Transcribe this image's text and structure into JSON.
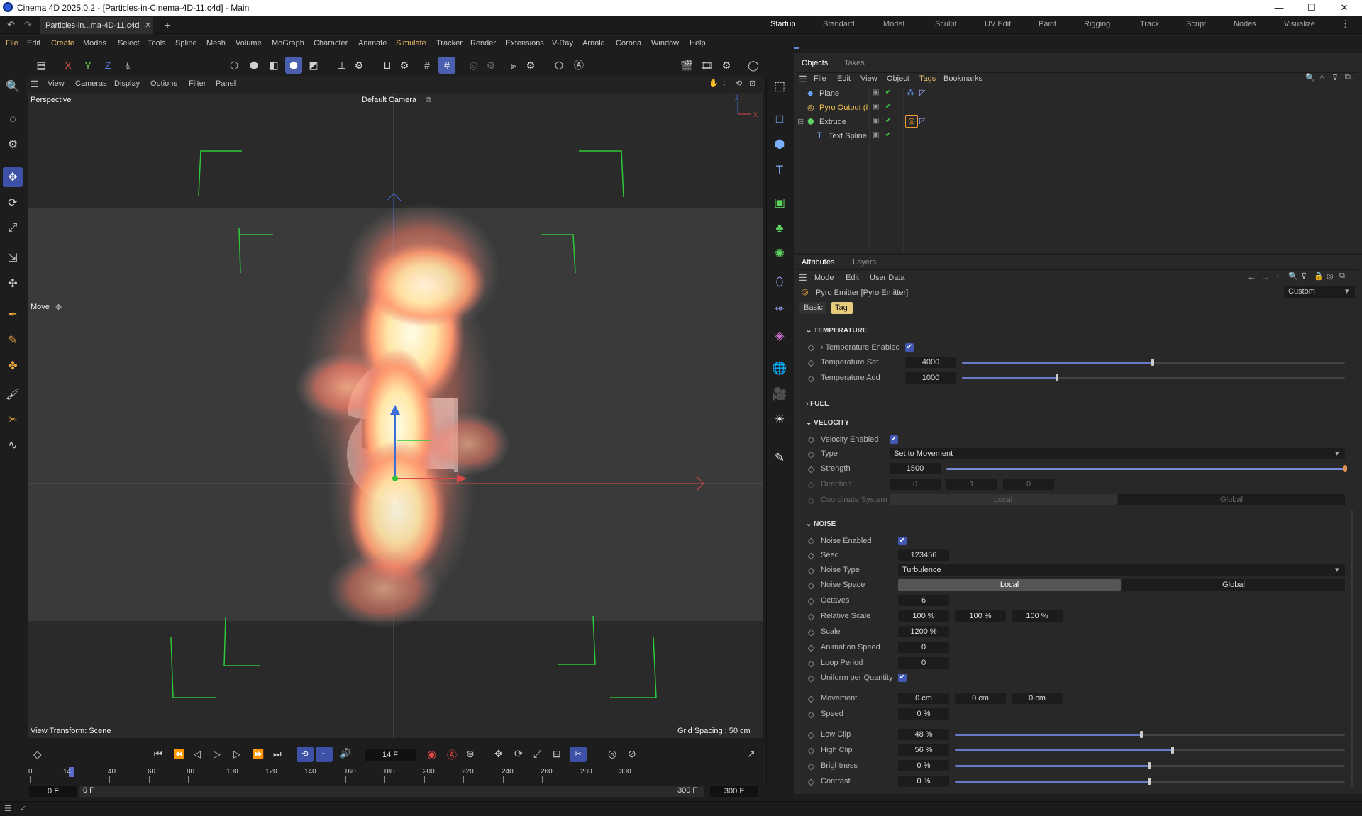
{
  "app": {
    "title": "Cinema 4D 2025.0.2 - [Particles-in-Cinema-4D-11.c4d] - Main",
    "doc_tab": "Particles-in...ma-4D-11.c4d",
    "window_controls": {
      "minimize": "—",
      "maximize": "☐",
      "close": "✕"
    }
  },
  "layouts": [
    "Startup",
    "Standard",
    "Model",
    "Sculpt",
    "UV Edit",
    "Paint",
    "Rigging",
    "Track",
    "Script",
    "Nodes",
    "Visualize"
  ],
  "menus": [
    "File",
    "Edit",
    "Create",
    "Modes",
    "Select",
    "Tools",
    "Spline",
    "Mesh",
    "Volume",
    "MoGraph",
    "Character",
    "Animate",
    "Simulate",
    "Tracker",
    "Render",
    "Extensions",
    "V-Ray",
    "Arnold",
    "Corona",
    "Window",
    "Help"
  ],
  "toolbar": {
    "axis_x": "X",
    "axis_y": "Y",
    "axis_z": "Z"
  },
  "viewport": {
    "menus": [
      "View",
      "Cameras",
      "Display",
      "Options",
      "Filter",
      "Panel"
    ],
    "name": "Perspective",
    "camera": "Default Camera",
    "tool": "Move",
    "view_transform": "View Transform: Scene",
    "grid_spacing": "Grid Spacing : 50 cm"
  },
  "objects_panel": {
    "tabs": [
      "Objects",
      "Takes"
    ],
    "menus": [
      "File",
      "Edit",
      "View",
      "Object",
      "Tags",
      "Bookmarks"
    ],
    "items": [
      {
        "name": "Plane",
        "color": "#c8c8c8"
      },
      {
        "name": "Pyro Output (I",
        "color": "#f0c050"
      },
      {
        "name": "Extrude",
        "color": "#c8c8c8"
      },
      {
        "name": "Text Spline",
        "color": "#c8c8c8"
      }
    ]
  },
  "attributes_panel": {
    "tabs": [
      "Attributes",
      "Layers"
    ],
    "menus": [
      "Mode",
      "Edit",
      "User Data"
    ],
    "object_title": "Pyro Emitter [Pyro Emitter]",
    "preset": "Custom",
    "subtabs": [
      "Basic",
      "Tag"
    ],
    "temperature": {
      "header": "TEMPERATURE",
      "enabled_label": "Temperature Enabled",
      "set_label": "Temperature Set",
      "set_value": "4000",
      "set_fraction": 0.5,
      "add_label": "Temperature Add",
      "add_value": "1000",
      "add_fraction": 0.25
    },
    "fuel": {
      "header": "FUEL"
    },
    "velocity": {
      "header": "VELOCITY",
      "enabled_label": "Velocity Enabled",
      "type_label": "Type",
      "type_value": "Set to Movement",
      "strength_label": "Strength",
      "strength_value": "1500",
      "strength_fraction": 1.0,
      "direction_label": "Direction",
      "direction_values": [
        "0",
        "1",
        "0"
      ],
      "coord_label": "Coordinate System",
      "coord_local": "Local",
      "coord_global": "Global"
    },
    "noise": {
      "header": "NOISE",
      "enabled_label": "Noise Enabled",
      "seed_label": "Seed",
      "seed_value": "123456",
      "type_label": "Noise Type",
      "type_value": "Turbulence",
      "space_label": "Noise Space",
      "space_local": "Local",
      "space_global": "Global",
      "octaves_label": "Octaves",
      "octaves_value": "6",
      "relscale_label": "Relative Scale",
      "relscale_values": [
        "100 %",
        "100 %",
        "100 %"
      ],
      "scale_label": "Scale",
      "scale_value": "1200 %",
      "animspeed_label": "Animation Speed",
      "animspeed_value": "0",
      "loop_label": "Loop Period",
      "loop_value": "0",
      "uniform_label": "Uniform per Quantity",
      "movement_label": "Movement",
      "movement_values": [
        "0 cm",
        "0 cm",
        "0 cm"
      ],
      "speed_label": "Speed",
      "speed_value": "0 %",
      "lowclip_label": "Low Clip",
      "lowclip_value": "48 %",
      "lowclip_fraction": 0.48,
      "highclip_label": "High Clip",
      "highclip_value": "56 %",
      "highclip_fraction": 0.56,
      "brightness_label": "Brightness",
      "brightness_value": "0 %",
      "brightness_fraction": 0.5,
      "contrast_label": "Contrast",
      "contrast_value": "0 %",
      "contrast_fraction": 0.5
    }
  },
  "timeline": {
    "current_frame": "14 F",
    "ruler_ticks": [
      "0",
      "14",
      "40",
      "60",
      "80",
      "100",
      "120",
      "140",
      "160",
      "180",
      "200",
      "220",
      "240",
      "260",
      "280",
      "300"
    ],
    "range_start": "0 F",
    "range_start2": "0 F",
    "range_end": "300 F",
    "range_end2": "300 F"
  }
}
